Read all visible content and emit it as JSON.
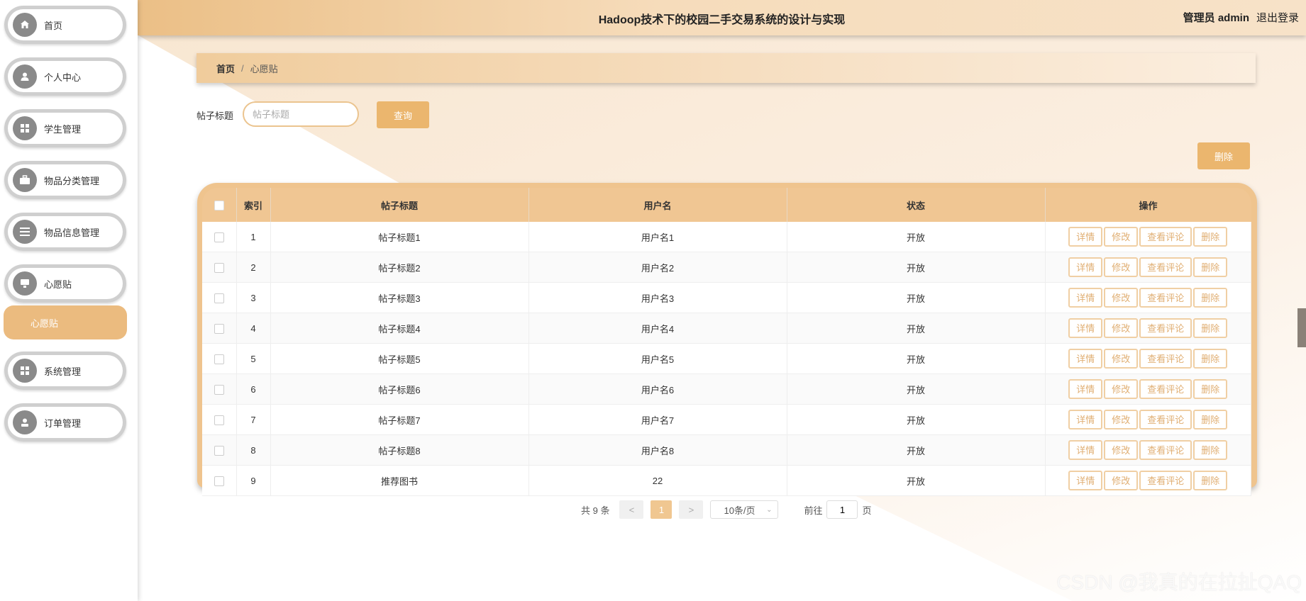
{
  "header": {
    "title": "Hadoop技术下的校园二手交易系统的设计与实现",
    "user": "管理员 admin",
    "logout": "退出登录"
  },
  "sidebar": {
    "items": [
      {
        "label": "首页",
        "icon": "home-icon"
      },
      {
        "label": "个人中心",
        "icon": "user-icon"
      },
      {
        "label": "学生管理",
        "icon": "grid-icon"
      },
      {
        "label": "物品分类管理",
        "icon": "briefcase-icon"
      },
      {
        "label": "物品信息管理",
        "icon": "list-icon"
      },
      {
        "label": "心愿贴",
        "icon": "monitor-icon"
      },
      {
        "label": "系统管理",
        "icon": "grid-icon"
      },
      {
        "label": "订单管理",
        "icon": "person-icon"
      }
    ],
    "sub_item": "心愿贴"
  },
  "breadcrumb": {
    "home": "首页",
    "separator": "/",
    "current": "心愿贴"
  },
  "search": {
    "label": "帖子标题",
    "placeholder": "帖子标题",
    "button": "查询"
  },
  "actions": {
    "delete": "删除"
  },
  "table": {
    "columns": [
      "索引",
      "帖子标题",
      "用户名",
      "状态",
      "操作"
    ],
    "rows": [
      {
        "index": "1",
        "title": "帖子标题1",
        "user": "用户名1",
        "status": "开放"
      },
      {
        "index": "2",
        "title": "帖子标题2",
        "user": "用户名2",
        "status": "开放"
      },
      {
        "index": "3",
        "title": "帖子标题3",
        "user": "用户名3",
        "status": "开放"
      },
      {
        "index": "4",
        "title": "帖子标题4",
        "user": "用户名4",
        "status": "开放"
      },
      {
        "index": "5",
        "title": "帖子标题5",
        "user": "用户名5",
        "status": "开放"
      },
      {
        "index": "6",
        "title": "帖子标题6",
        "user": "用户名6",
        "status": "开放"
      },
      {
        "index": "7",
        "title": "帖子标题7",
        "user": "用户名7",
        "status": "开放"
      },
      {
        "index": "8",
        "title": "帖子标题8",
        "user": "用户名8",
        "status": "开放"
      },
      {
        "index": "9",
        "title": "推荐图书",
        "user": "22",
        "status": "开放"
      }
    ],
    "row_actions": [
      "详情",
      "修改",
      "查看评论",
      "删除"
    ]
  },
  "pagination": {
    "total": "共 9 条",
    "prev": "<",
    "page": "1",
    "next": ">",
    "page_size": "10条/页",
    "goto_label": "前往",
    "goto_value": "1",
    "page_suffix": "页"
  },
  "watermark": "CSDN @我真的在拉扯QAQ",
  "colors": {
    "accent": "#ebb66e",
    "header_gradient_start": "#ebbf86",
    "table_frame": "#efc48e"
  }
}
